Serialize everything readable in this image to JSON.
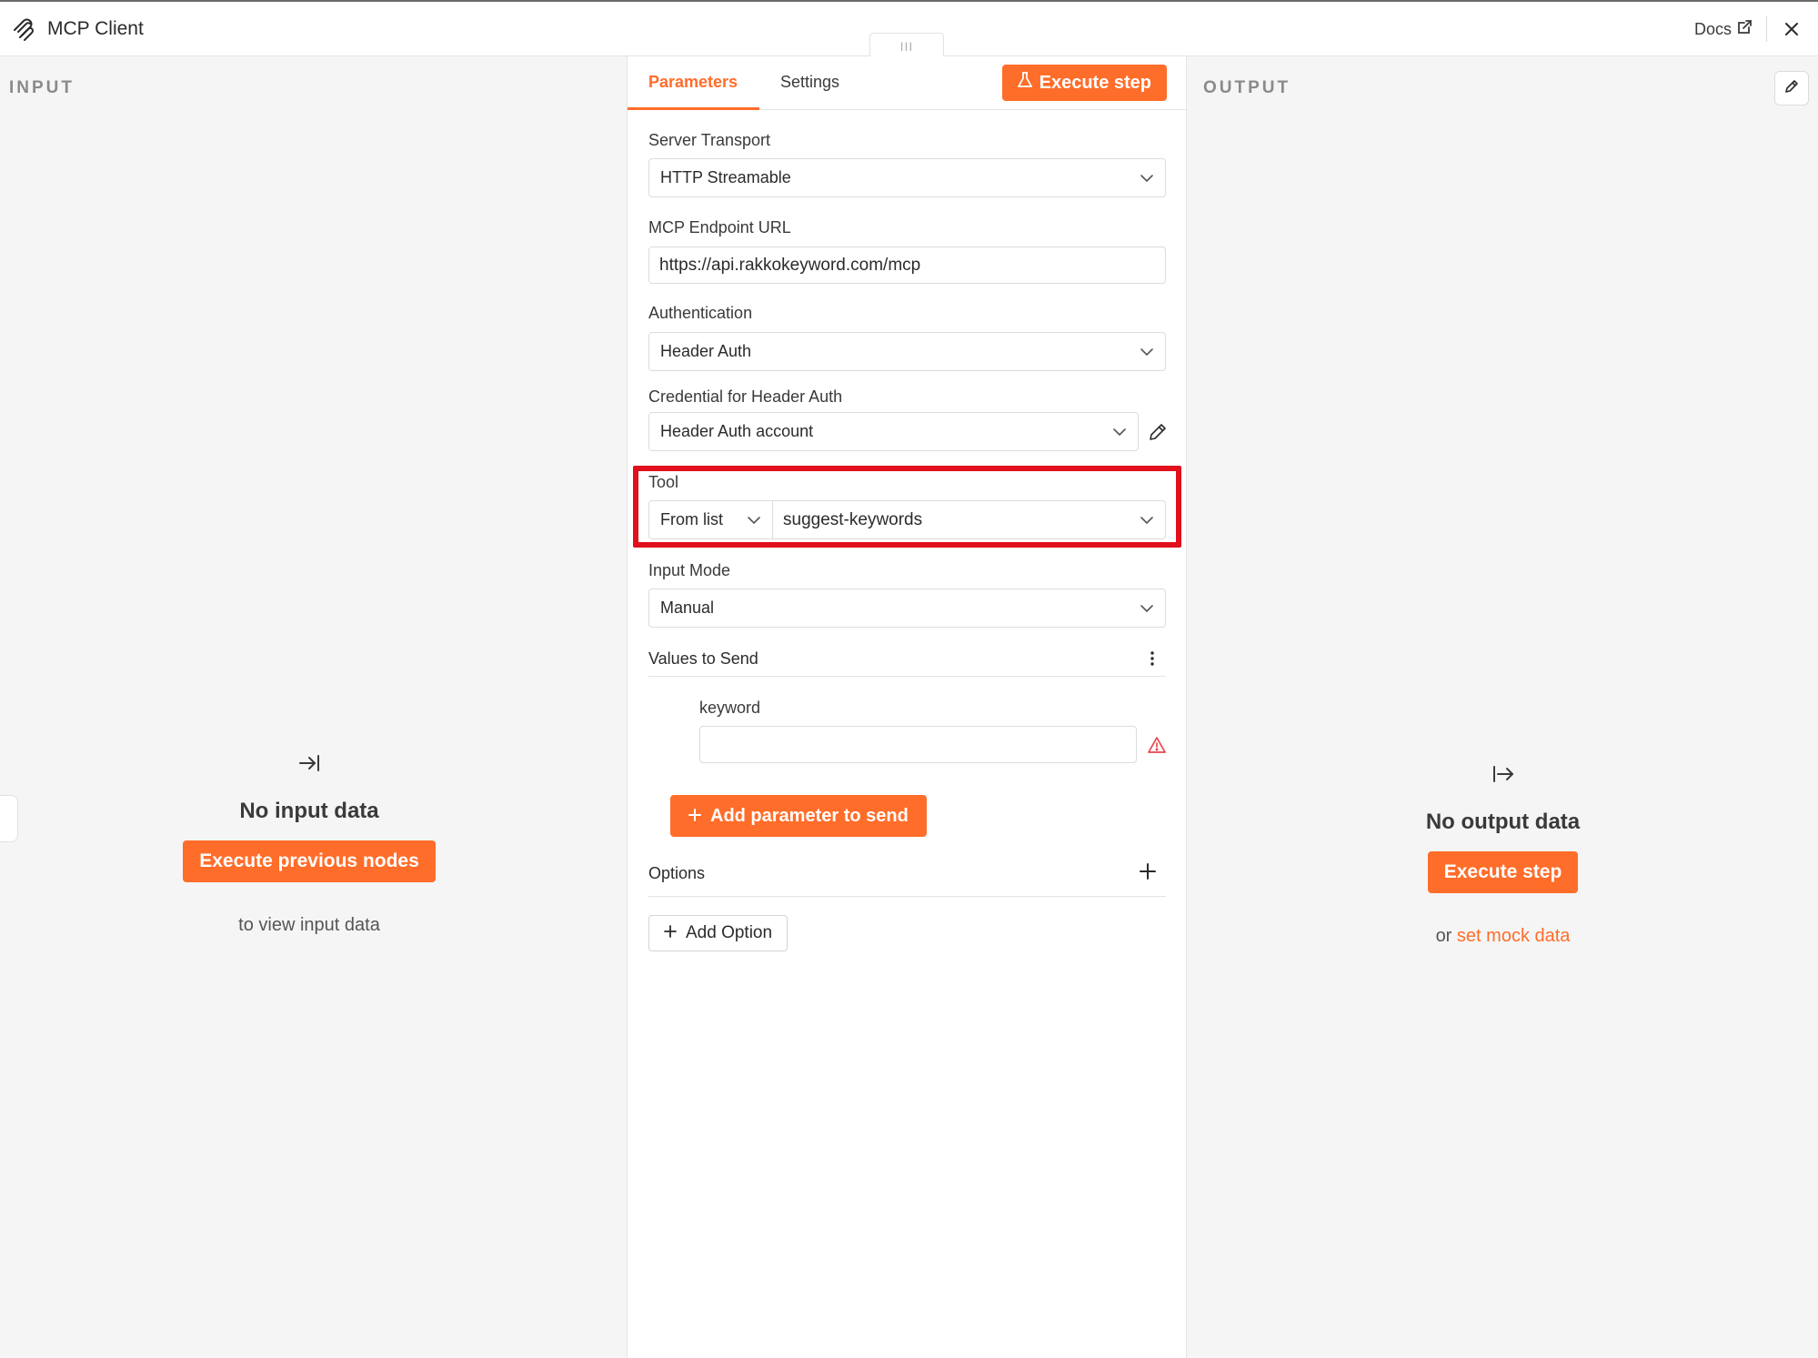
{
  "header": {
    "title": "MCP Client",
    "docs_label": "Docs",
    "icons": {
      "logo": "mcp-logo-icon",
      "external": "external-link-icon",
      "close": "close-icon"
    }
  },
  "drag_handle": {
    "glyph": "III"
  },
  "input_panel": {
    "label": "INPUT",
    "empty_heading": "No input data",
    "button_label": "Execute previous nodes",
    "sub_text": "to view input data"
  },
  "output_panel": {
    "label": "OUTPUT",
    "empty_heading": "No output data",
    "button_label": "Execute step",
    "sub_prefix": "or",
    "sub_link": "set mock data"
  },
  "tabs": [
    {
      "label": "Parameters",
      "active": true
    },
    {
      "label": "Settings",
      "active": false
    }
  ],
  "execute_button": {
    "label": "Execute step",
    "icon": "flask-icon"
  },
  "fields": {
    "server_transport": {
      "label": "Server Transport",
      "value": "HTTP Streamable"
    },
    "endpoint_url": {
      "label": "MCP Endpoint URL",
      "value": "https://api.rakkokeyword.com/mcp"
    },
    "authentication": {
      "label": "Authentication",
      "value": "Header Auth"
    },
    "credential": {
      "label": "Credential for Header Auth",
      "value": "Header Auth account"
    },
    "tool": {
      "label": "Tool",
      "mode": "From list",
      "value": "suggest-keywords"
    },
    "input_mode": {
      "label": "Input Mode",
      "value": "Manual"
    }
  },
  "values_to_send": {
    "label": "Values to Send",
    "param_label": "keyword",
    "param_value": "",
    "add_button": "Add parameter to send"
  },
  "options": {
    "label": "Options",
    "add_button": "Add Option"
  },
  "colors": {
    "accent": "#ff6d2a",
    "highlight": "#e0101c"
  }
}
